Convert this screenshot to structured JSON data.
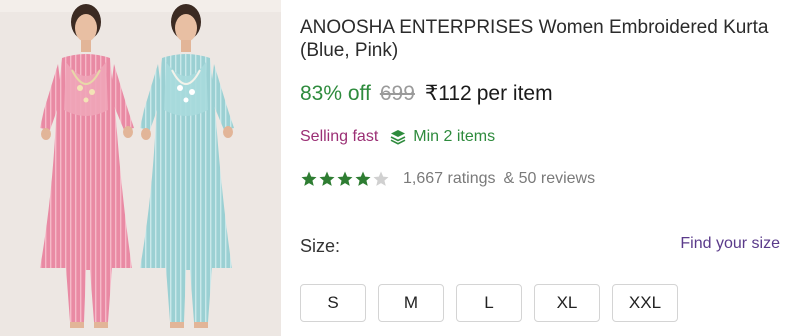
{
  "product": {
    "title": "ANOOSHA ENTERPRISES Women Embroidered Kurta (Blue, Pink)",
    "discount": "83% off",
    "mrp": "699",
    "price": "₹112",
    "price_suffix": "per item"
  },
  "badges": {
    "selling_fast": "Selling fast",
    "min_items": "Min 2 items",
    "min_items_icon": "layers-icon"
  },
  "rating": {
    "stars": 4,
    "star_color": "#2e7d32",
    "ratings_text": "1,667 ratings",
    "reviews_text": "& 50 reviews"
  },
  "size": {
    "label": "Size:",
    "find_link": "Find your size",
    "options": [
      "S",
      "M",
      "L",
      "XL",
      "XXL"
    ]
  },
  "colors": {
    "discount": "#2e8b3d",
    "selling_fast": "#9b2f75",
    "link": "#5a3a8a"
  }
}
